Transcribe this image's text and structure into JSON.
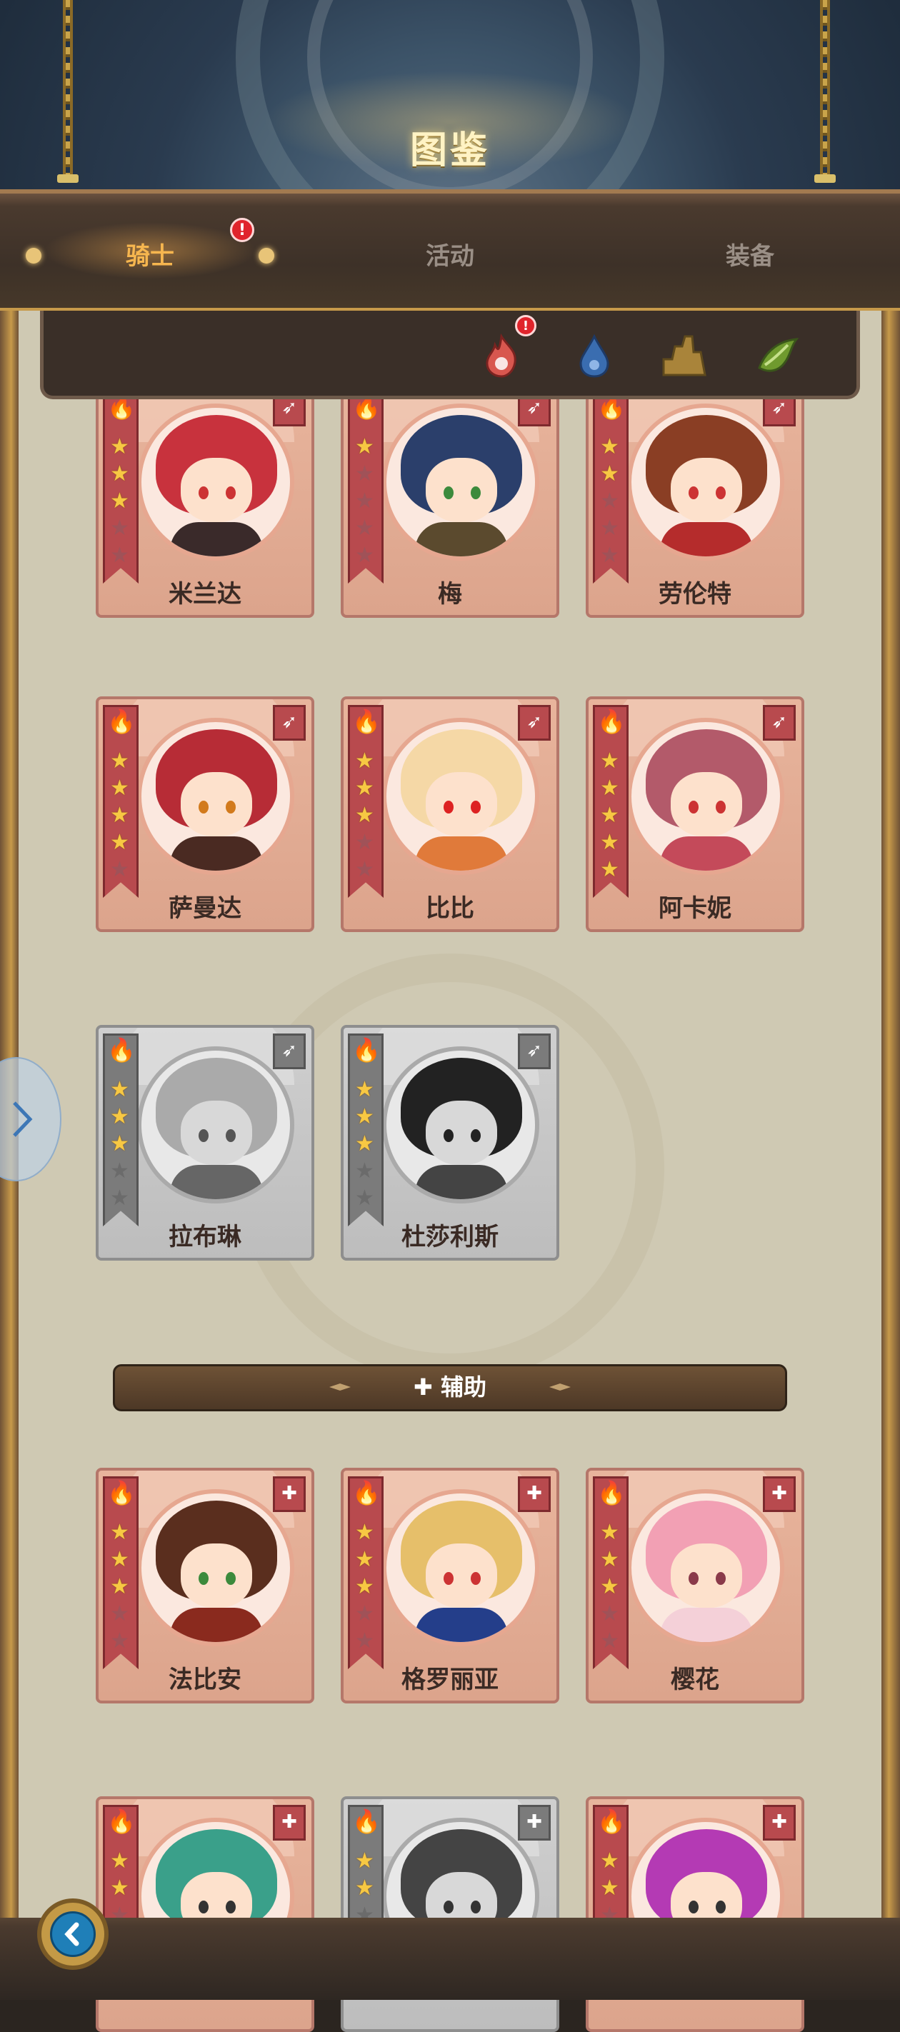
{
  "header": {
    "title": "图鉴"
  },
  "tabs": [
    {
      "label": "骑士",
      "active": true,
      "badge": "!"
    },
    {
      "label": "活动",
      "active": false
    },
    {
      "label": "装备",
      "active": false
    }
  ],
  "filters": [
    {
      "icon": "fire-element-icon",
      "badge": "!",
      "color": "#d8574f"
    },
    {
      "icon": "water-element-icon",
      "color": "#3a6db0"
    },
    {
      "icon": "earth-element-icon",
      "color": "#a9843a"
    },
    {
      "icon": "wind-element-icon",
      "color": "#6f9a2e"
    }
  ],
  "knights": [
    {
      "name": "米兰达",
      "stars": 3,
      "class": "ranged",
      "element": "fire",
      "hair": "#c8323d",
      "outfit": "#3a2a2a",
      "eyes": "#c33",
      "gray": false
    },
    {
      "name": "梅",
      "stars": 1,
      "class": "ranged",
      "element": "fire",
      "hair": "#2b3f6b",
      "outfit": "#5b4a2e",
      "eyes": "#3c8a3c",
      "gray": false
    },
    {
      "name": "劳伦特",
      "stars": 2,
      "class": "ranged",
      "element": "fire",
      "hair": "#8a3e24",
      "outfit": "#b52c2c",
      "eyes": "#c33",
      "gray": false
    },
    {
      "name": "萨曼达",
      "stars": 4,
      "class": "ranged",
      "element": "fire",
      "hair": "#b72c36",
      "outfit": "#4a2a22",
      "eyes": "#d27a1c",
      "gray": false
    },
    {
      "name": "比比",
      "stars": 3,
      "class": "ranged",
      "element": "fire",
      "hair": "#f5d8a6",
      "outfit": "#e07a3a",
      "eyes": "#d22",
      "gray": false
    },
    {
      "name": "阿卡妮",
      "stars": 5,
      "class": "ranged",
      "element": "fire",
      "hair": "#b35a6a",
      "outfit": "#c44a5a",
      "eyes": "#c33",
      "gray": false
    },
    {
      "name": "拉布琳",
      "stars": 3,
      "class": "ranged",
      "element": "fire",
      "hair": "#aaaaaa",
      "outfit": "#666666",
      "eyes": "#555",
      "gray": true
    },
    {
      "name": "杜莎利斯",
      "stars": 3,
      "class": "ranged",
      "element": "fire",
      "hair": "#222222",
      "outfit": "#444444",
      "eyes": "#222",
      "gray": true
    }
  ],
  "support_section": {
    "label": "辅助",
    "icon": "plus-icon"
  },
  "supports": [
    {
      "name": "法比安",
      "stars": 3,
      "class": "support",
      "element": "fire",
      "hair": "#5a2e1e",
      "outfit": "#8a2a1e",
      "eyes": "#3c8a3c",
      "gray": false
    },
    {
      "name": "格罗丽亚",
      "stars": 3,
      "class": "support",
      "element": "fire",
      "hair": "#e6bf6a",
      "outfit": "#243e8a",
      "eyes": "#c33",
      "gray": false
    },
    {
      "name": "樱花",
      "stars": 3,
      "class": "support",
      "element": "fire",
      "hair": "#f2a0b4",
      "outfit": "#f4d0d8",
      "eyes": "#8a3a4a",
      "gray": false
    },
    {
      "name": "",
      "stars": 2,
      "class": "support",
      "element": "fire",
      "hair": "#3aa08a",
      "outfit": "#7a5a2a",
      "eyes": "#333",
      "gray": false
    },
    {
      "name": "",
      "stars": 2,
      "class": "support",
      "element": "fire",
      "hair": "#444444",
      "outfit": "#777777",
      "eyes": "#333",
      "gray": true
    },
    {
      "name": "",
      "stars": 2,
      "class": "support",
      "element": "fire",
      "hair": "#b43ab4",
      "outfit": "#e0b03a",
      "eyes": "#333",
      "gray": false
    }
  ],
  "max_stars": 5,
  "buttons": {
    "back_icon": "back-arrow-icon",
    "side_icon": "chevron-right-icon"
  }
}
